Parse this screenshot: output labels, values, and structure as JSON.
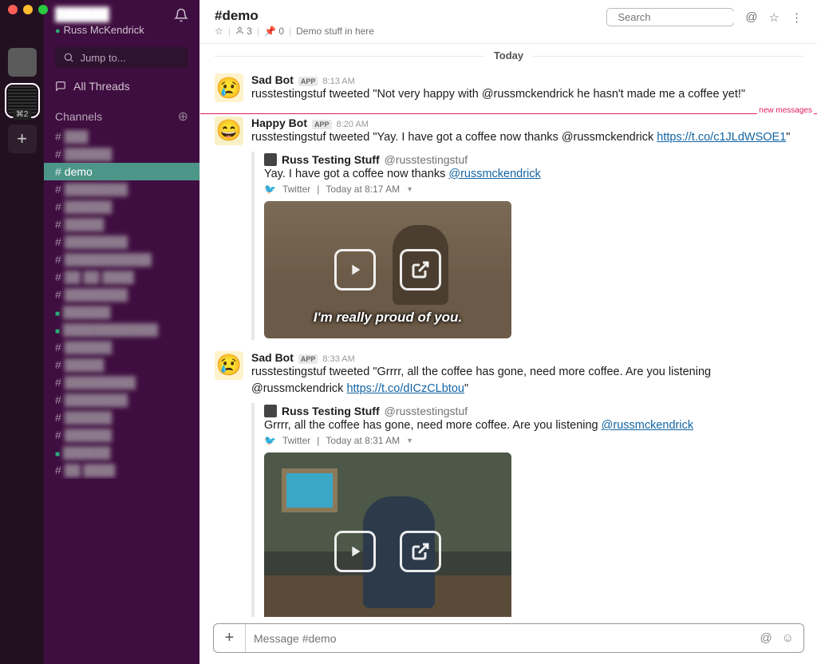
{
  "window": {
    "traffic": true
  },
  "workspace": {
    "badge": "⌘2"
  },
  "sidebar": {
    "team_name": "██████",
    "user_name": "Russ McKendrick",
    "jump_label": "Jump to...",
    "all_threads_label": "All Threads",
    "channels_header": "Channels",
    "active_channel": "demo"
  },
  "header": {
    "channel": "#demo",
    "members": "3",
    "pins": "0",
    "topic": "Demo stuff in here",
    "search_placeholder": "Search"
  },
  "divider_label": "Today",
  "new_messages_label": "new messages",
  "messages": [
    {
      "author": "Sad Bot",
      "is_app": true,
      "time": "8:13 AM",
      "avatar": "😢",
      "text": "russtestingstuf  tweeted \"Not very happy with @russmckendrick he hasn't made me a coffee yet!\""
    },
    {
      "author": "Happy Bot",
      "is_app": true,
      "time": "8:20 AM",
      "avatar": "😄",
      "text_prefix": "russtestingstuf  tweeted \"Yay. I have got a coffee now thanks @russmckendrick ",
      "text_link": "https://t.co/c1JLdWSOE1",
      "text_suffix": "\"",
      "attachment": {
        "title": "Russ Testing Stuff",
        "handle": "@russtestingstuf",
        "body_prefix": "Yay. I have got a coffee now thanks ",
        "body_link": "@russmckendrick",
        "source": "Twitter",
        "meta_time": "Today at 8:17 AM",
        "caption": "I'm really proud of you."
      }
    },
    {
      "author": "Sad Bot",
      "is_app": true,
      "time": "8:33 AM",
      "avatar": "😢",
      "text_prefix": "russtestingstuf  tweeted \"Grrrr, all the coffee has gone, need more coffee. Are you listening @russmckendrick ",
      "text_link": "https://t.co/dICzCLbtou",
      "text_suffix": "\"",
      "attachment": {
        "title": "Russ Testing Stuff",
        "handle": "@russtestingstuf",
        "body_prefix": "Grrrr, all the coffee has gone, need more coffee. Are you listening ",
        "body_link": "@russmckendrick",
        "source": "Twitter",
        "meta_time": "Today at 8:31 AM"
      }
    }
  ],
  "composer": {
    "placeholder": "Message #demo"
  }
}
